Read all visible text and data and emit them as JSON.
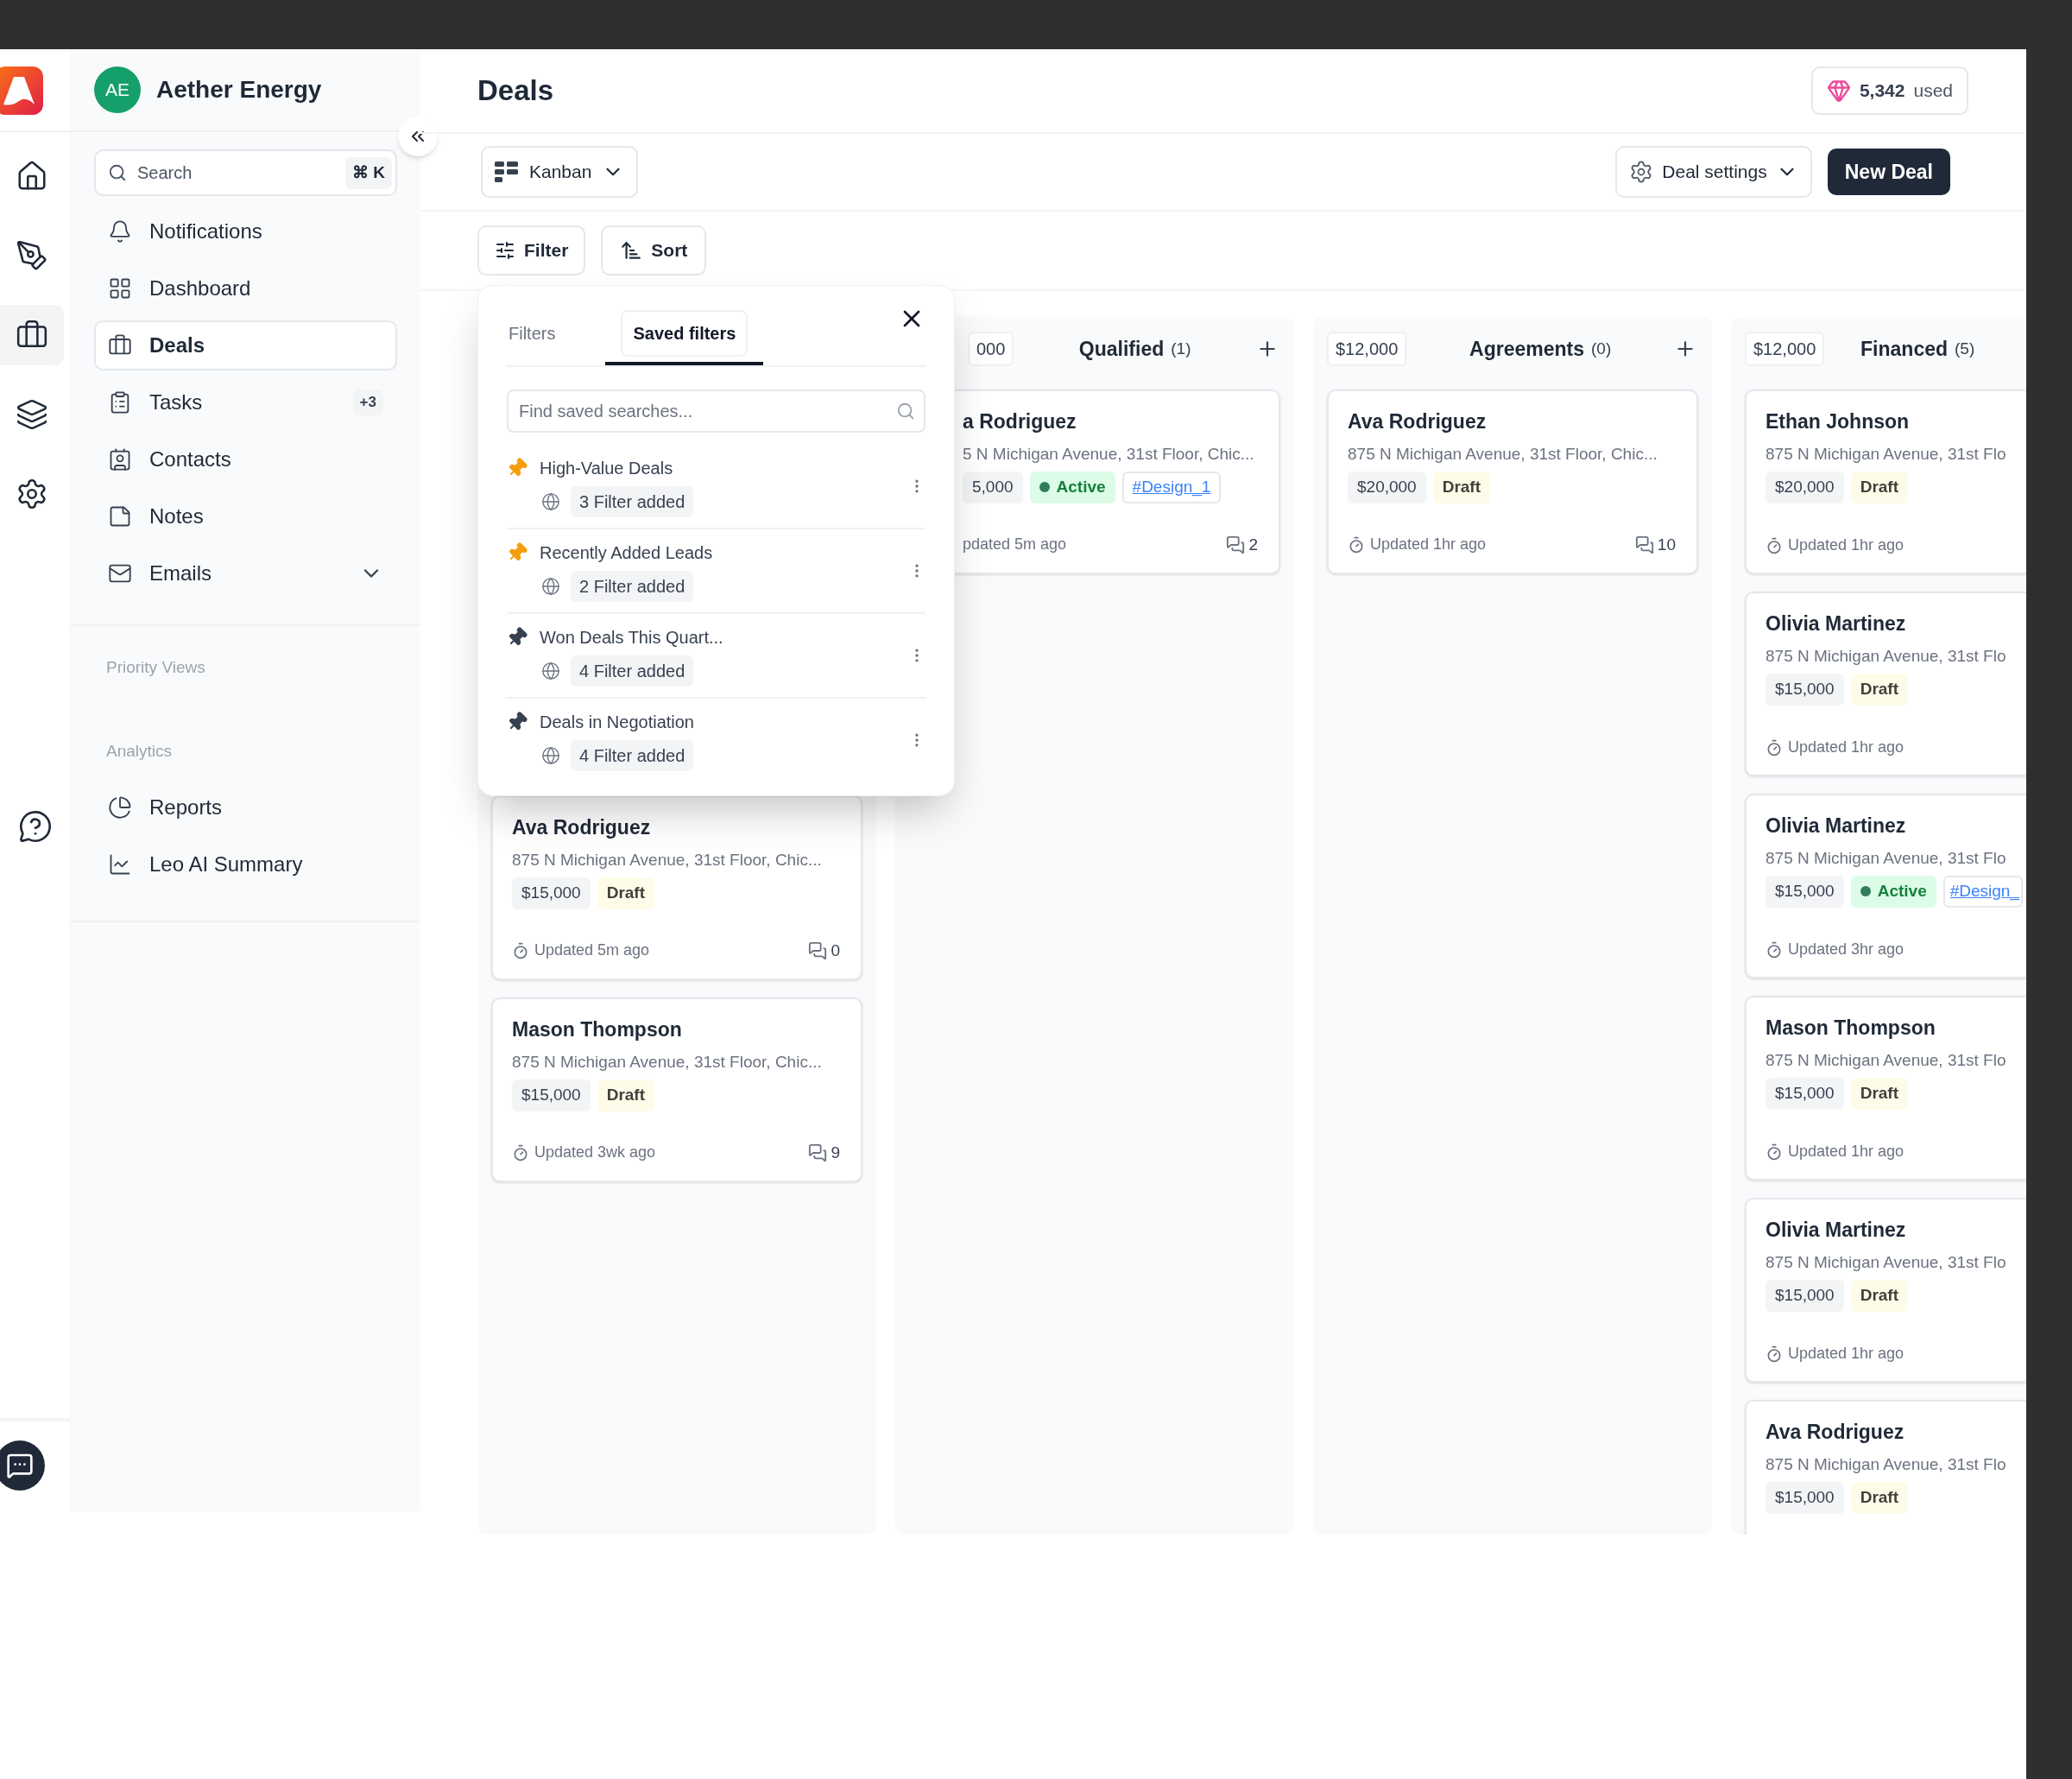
{
  "app_rail": {
    "items": [
      {
        "kind": "home",
        "selected": false
      },
      {
        "kind": "pen",
        "selected": false
      },
      {
        "kind": "briefcase",
        "selected": true
      },
      {
        "kind": "layers",
        "selected": false
      },
      {
        "kind": "settings",
        "selected": false
      }
    ]
  },
  "workspace": {
    "initials": "AE",
    "name": "Aether Energy"
  },
  "search": {
    "placeholder": "Search",
    "shortcut": "⌘ K"
  },
  "nav": [
    {
      "kind": "bell",
      "label": "Notifications",
      "selected": false
    },
    {
      "kind": "grid",
      "label": "Dashboard",
      "selected": false
    },
    {
      "kind": "briefcase",
      "label": "Deals",
      "selected": true
    },
    {
      "kind": "clipboard",
      "label": "Tasks",
      "selected": false,
      "badge": "+3"
    },
    {
      "kind": "contacts",
      "label": "Contacts",
      "selected": false
    },
    {
      "kind": "note",
      "label": "Notes",
      "selected": false
    },
    {
      "kind": "mail",
      "label": "Emails",
      "selected": false,
      "expanded": false
    }
  ],
  "sections": [
    {
      "title": "Priority Views"
    },
    {
      "title": "Analytics",
      "items": [
        {
          "kind": "pie",
          "label": "Reports",
          "selected": false
        },
        {
          "kind": "chart",
          "label": "Leo AI Summary",
          "selected": false
        }
      ]
    }
  ],
  "page": {
    "title": "Deals",
    "credits": {
      "value": "5,342",
      "unit": "used"
    }
  },
  "toolbar": {
    "view": "Kanban",
    "settings": "Deal settings",
    "primary": "New Deal"
  },
  "filter_bar": {
    "filter": "Filter",
    "sort": "Sort"
  },
  "filter_popover": {
    "tabs": [
      {
        "label": "Filters",
        "selected": false
      },
      {
        "label": "Saved filters",
        "selected": true
      }
    ],
    "search_placeholder": "Find saved searches...",
    "saved": [
      {
        "name": "High-Value Deals",
        "pinned": true,
        "count": "3 Filter added"
      },
      {
        "name": "Recently Added Leads",
        "pinned": true,
        "count": "2 Filter added"
      },
      {
        "name": "Won Deals This Quart...",
        "pinned": false,
        "count": "4 Filter added"
      },
      {
        "name": "Deals in Negotiation",
        "pinned": false,
        "count": "4 Filter added"
      }
    ]
  },
  "columns": [
    {
      "cards": [
        {
          "name": "Ava Rodriguez",
          "address": "875 N Michigan Avenue, 31st Floor, Chic...",
          "amount": "$15,000",
          "status": {
            "kind": "draft",
            "label": "Draft"
          },
          "updated": "Updated 5m ago",
          "comments": "0"
        },
        {
          "name": "Mason Thompson",
          "address": "875 N Michigan Avenue, 31st Floor, Chic...",
          "amount": "$15,000",
          "status": {
            "kind": "draft",
            "label": "Draft"
          },
          "updated": "Updated 3wk ago",
          "comments": "9"
        }
      ]
    },
    {
      "amount": "000",
      "title": "Qualified",
      "count": "(1)",
      "add": true,
      "cards": [
        {
          "name": "a Rodriguez",
          "address": "5 N Michigan Avenue, 31st Floor, Chic...",
          "amount": "5,000",
          "status": {
            "kind": "active",
            "label": "Active"
          },
          "tag": "#Design_1",
          "updated": "pdated 5m ago",
          "comments": "2"
        }
      ]
    },
    {
      "amount": "$12,000",
      "title": "Agreements",
      "count": "(0)",
      "add": true,
      "cards": [
        {
          "name": "Ava Rodriguez",
          "address": "875 N Michigan Avenue, 31st Floor, Chic...",
          "amount": "$20,000",
          "status": {
            "kind": "draft",
            "label": "Draft"
          },
          "updated": "Updated 1hr ago",
          "comments": "10"
        }
      ]
    },
    {
      "amount": "$12,000",
      "title": "Financed",
      "count": "(5)",
      "add": false,
      "cards": [
        {
          "name": "Ethan Johnson",
          "address": "875 N Michigan Avenue, 31st Flo",
          "amount": "$20,000",
          "status": {
            "kind": "draft",
            "label": "Draft"
          },
          "updated": "Updated 1hr ago"
        },
        {
          "name": "Olivia Martinez",
          "address": "875 N Michigan Avenue, 31st Flo",
          "amount": "$15,000",
          "status": {
            "kind": "draft",
            "label": "Draft"
          },
          "updated": "Updated 1hr ago"
        },
        {
          "name": "Olivia Martinez",
          "address": "875 N Michigan Avenue, 31st Flo",
          "amount": "$15,000",
          "status": {
            "kind": "active",
            "label": "Active"
          },
          "tag": "#Design_",
          "updated": "Updated 3hr ago"
        },
        {
          "name": "Mason Thompson",
          "address": "875 N Michigan Avenue, 31st Flo",
          "amount": "$15,000",
          "status": {
            "kind": "draft",
            "label": "Draft"
          },
          "updated": "Updated 1hr ago"
        },
        {
          "name": "Olivia Martinez",
          "address": "875 N Michigan Avenue, 31st Flo",
          "amount": "$15,000",
          "status": {
            "kind": "draft",
            "label": "Draft"
          },
          "updated": "Updated 1hr ago"
        },
        {
          "name": "Ava Rodriguez",
          "address": "875 N Michigan Avenue, 31st Flo",
          "amount": "$15,000",
          "status": {
            "kind": "draft",
            "label": "Draft"
          }
        }
      ]
    }
  ]
}
